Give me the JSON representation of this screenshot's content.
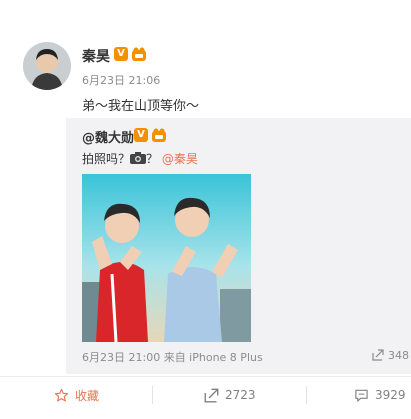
{
  "post": {
    "author": "秦昊",
    "timestamp": "6月23日 21:06",
    "text": "弟～我在山顶等你～",
    "verified_badge": "V"
  },
  "repost": {
    "author": "@魏大勋",
    "verified_badge": "V",
    "text_prefix": "拍照吗？",
    "text_mid": "？",
    "mention": "@秦昊",
    "meta": "6月23日 21:00 来自 iPhone 8 Plus",
    "share_count": "348"
  },
  "actions": {
    "favorite": "收藏",
    "repost": "2723",
    "comment": "3929"
  },
  "colors": {
    "accent": "#eb7350",
    "badge": "#f29100",
    "muted": "#8c8c8c",
    "repost_bg": "#f2f2f5"
  },
  "icons": {
    "favorite": "star-icon",
    "repost": "share-icon",
    "comment": "comment-icon",
    "camera": "camera-icon"
  }
}
